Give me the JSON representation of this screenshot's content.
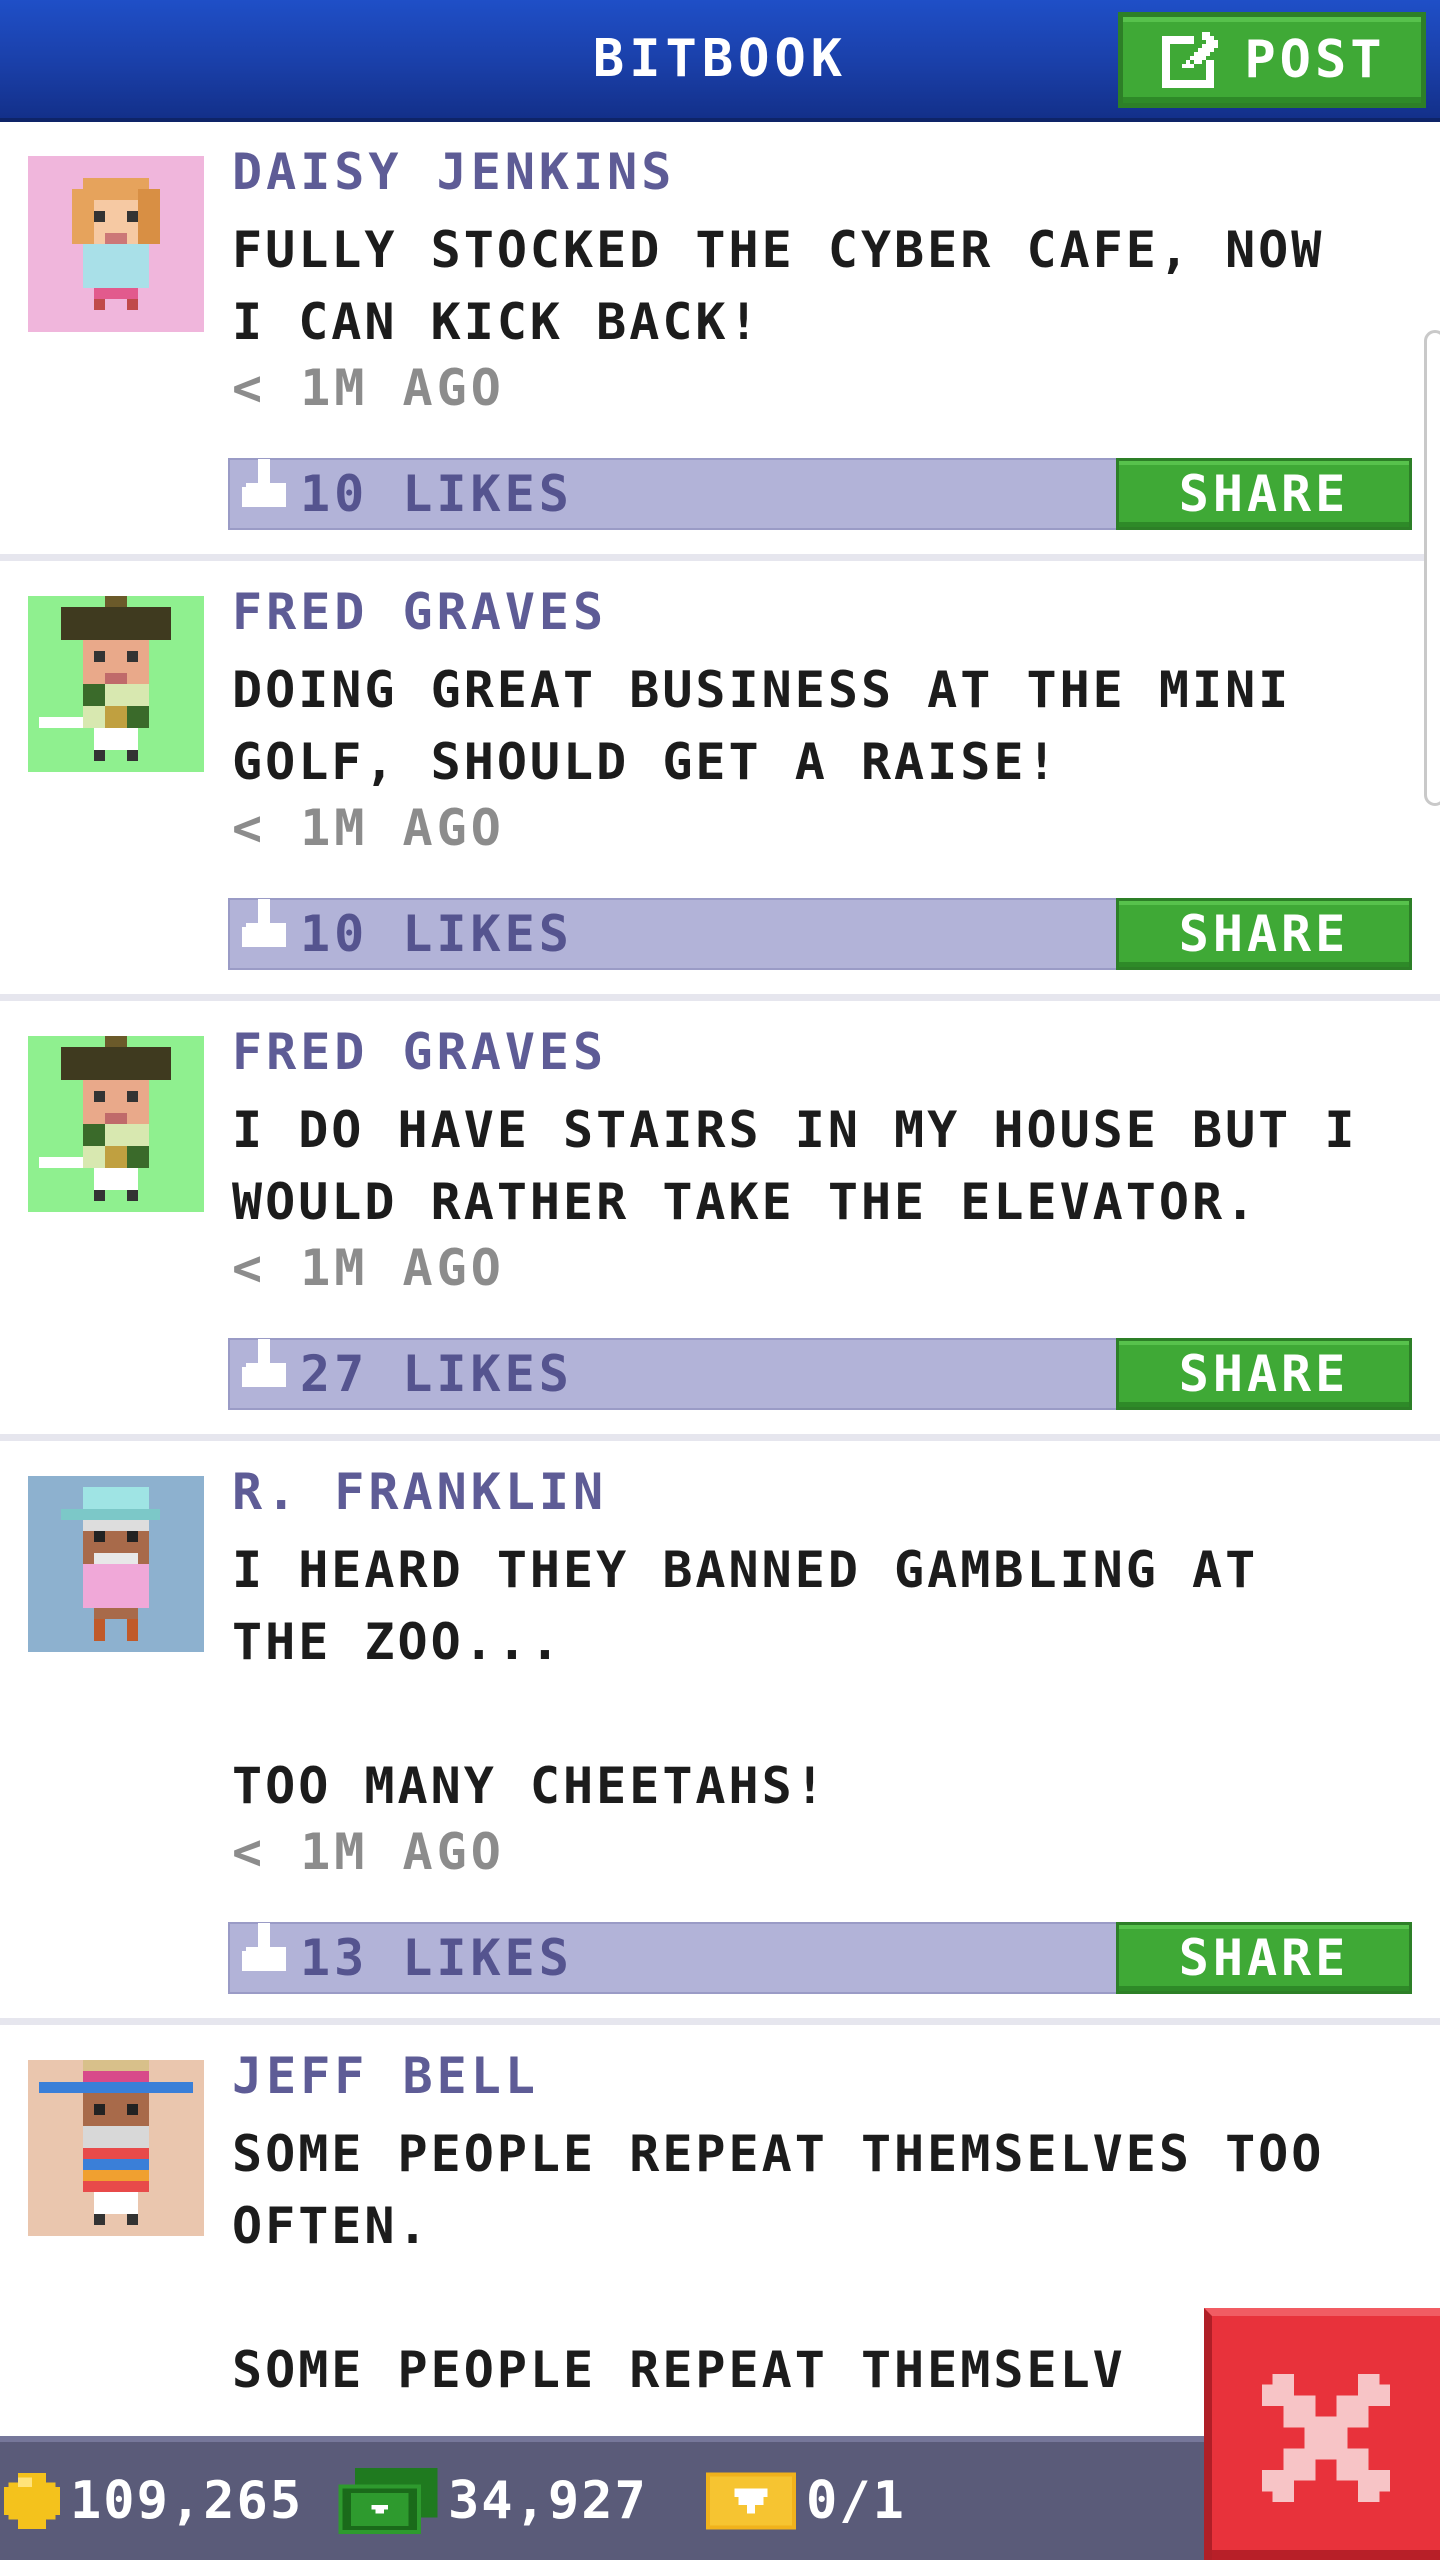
{
  "header": {
    "title": "BITBOOK",
    "post_label": "POST"
  },
  "posts": [
    {
      "author": "DAISY JENKINS",
      "text": "FULLY STOCKED THE CYBER CAFE, NOW\nI CAN KICK BACK!",
      "time": "< 1M AGO",
      "likes": "10 LIKES",
      "share_label": "SHARE",
      "avatar_icon": "girl-avatar-icon",
      "avatar_bg": "#f0b6dc"
    },
    {
      "author": "FRED GRAVES",
      "text": "DOING GREAT BUSINESS AT THE MINI\nGOLF, SHOULD GET A RAISE!",
      "time": "< 1M AGO",
      "likes": "10 LIKES",
      "share_label": "SHARE",
      "avatar_icon": "golfer-avatar-icon",
      "avatar_bg": "#8ff08f"
    },
    {
      "author": "FRED GRAVES",
      "text": "I DO HAVE STAIRS IN MY HOUSE BUT I\nWOULD RATHER TAKE THE ELEVATOR.",
      "time": "< 1M AGO",
      "likes": "27 LIKES",
      "share_label": "SHARE",
      "avatar_icon": "golfer-avatar-icon",
      "avatar_bg": "#8ff08f"
    },
    {
      "author": "R. FRANKLIN",
      "text": "I HEARD THEY BANNED GAMBLING AT\nTHE ZOO...\n\nTOO MANY CHEETAHS!",
      "time": "< 1M AGO",
      "likes": "13 LIKES",
      "share_label": "SHARE",
      "avatar_icon": "capped-man-avatar-icon",
      "avatar_bg": "#8db1cf"
    },
    {
      "author": "JEFF BELL",
      "text": "SOME PEOPLE REPEAT THEMSELVES TOO\nOFTEN.\n\nSOME PEOPLE REPEAT THEMSELV",
      "avatar_icon": "sombrero-man-avatar-icon",
      "avatar_bg": "#eac6ae"
    }
  ],
  "status": {
    "coins": "109,265",
    "bux": "34,927",
    "tickets": "0/1"
  },
  "colors": {
    "header_blue": "#1a3fa8",
    "button_green": "#3fa936",
    "likes_bar": "#b2b3d8",
    "author_purple": "#5e5c96",
    "close_red": "#e8323b",
    "bottom_bar": "#5a5b79"
  }
}
